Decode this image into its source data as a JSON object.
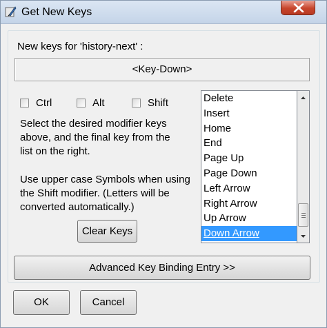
{
  "window": {
    "title": "Get New Keys"
  },
  "new_keys_label": "New keys for  'history-next' :",
  "key_display": "<Key-Down>",
  "modifiers": [
    {
      "label": "Ctrl",
      "checked": false
    },
    {
      "label": "Alt",
      "checked": false
    },
    {
      "label": "Shift",
      "checked": false
    }
  ],
  "help_text": {
    "p1_line1": "Select the desired modifier keys",
    "p1_line2": "above, and the final key from the",
    "p1_line3": "list on the right.",
    "p2_line1": "Use upper case Symbols when using",
    "p2_line2": "the Shift modifier.  (Letters will be",
    "p2_line3": "converted automatically.)"
  },
  "clear_keys_label": "Clear Keys",
  "key_list": {
    "items": [
      "Delete",
      "Insert",
      "Home",
      "End",
      "Page Up",
      "Page Down",
      "Left Arrow",
      "Right Arrow",
      "Up Arrow",
      "Down Arrow"
    ],
    "selected": "Down Arrow"
  },
  "advanced_label": "Advanced Key Binding Entry >>",
  "ok_label": "OK",
  "cancel_label": "Cancel",
  "colors": {
    "selection": "#3399ff",
    "close_button": "#c7452c"
  },
  "icons": {
    "app": "python-feather-icon",
    "close": "close-x-icon"
  }
}
